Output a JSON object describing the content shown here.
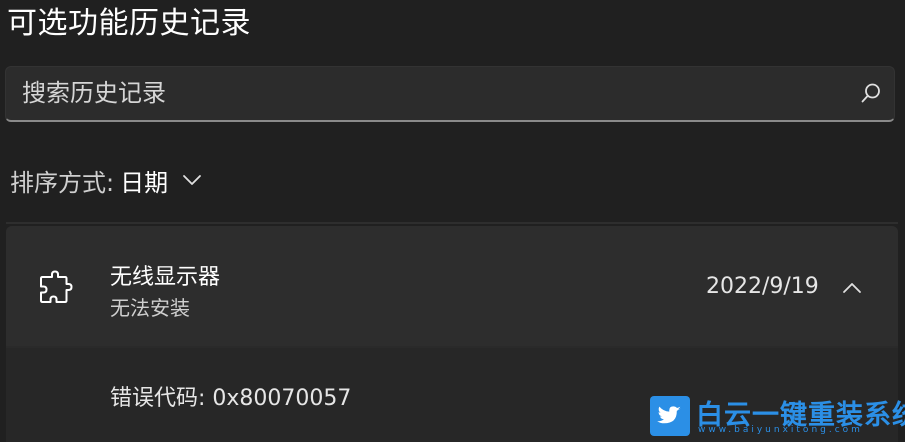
{
  "page": {
    "title": "可选功能历史记录"
  },
  "search": {
    "placeholder": "搜索历史记录",
    "icon": "search-icon"
  },
  "sort": {
    "label": "排序方式:",
    "value": "日期",
    "icon": "chevron-down-icon"
  },
  "history_items": [
    {
      "name": "无线显示器",
      "status": "无法安装",
      "date": "2022/9/19",
      "icon": "puzzle-piece-icon",
      "expanded": true,
      "expand_icon": "chevron-up-icon",
      "detail": "错误代码: 0x80070057"
    }
  ],
  "watermark": {
    "text": "白云一键重装系统",
    "url": "www.baiyunxitong.com",
    "icon": "twitter-bird-icon",
    "color": "#2b8fe6"
  },
  "colors": {
    "background": "#202020",
    "card": "#2d2d2d",
    "search_field": "#2c2c2c"
  }
}
